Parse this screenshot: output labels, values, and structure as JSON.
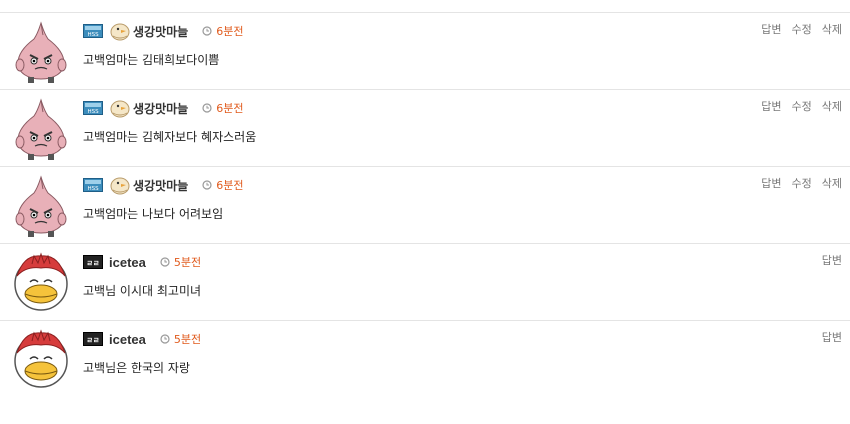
{
  "comments": [
    {
      "avatar_icon": "garlic-character-icon",
      "level_icon": "level-badge-icon",
      "nick_icon": "bird-emblem-icon",
      "nickname": "생강맛마늘",
      "time": "6분전",
      "text": "고백엄마는 김태희보다이쁨",
      "actions": {
        "reply": "답변",
        "edit": "수정",
        "delete": "삭제"
      }
    },
    {
      "avatar_icon": "garlic-character-icon",
      "level_icon": "level-badge-icon",
      "nick_icon": "bird-emblem-icon",
      "nickname": "생강맛마늘",
      "time": "6분전",
      "text": "고백엄마는 김혜자보다 혜자스러움",
      "actions": {
        "reply": "답변",
        "edit": "수정",
        "delete": "삭제"
      }
    },
    {
      "avatar_icon": "garlic-character-icon",
      "level_icon": "level-badge-icon",
      "nick_icon": "bird-emblem-icon",
      "nickname": "생강맛마늘",
      "time": "6분전",
      "text": "고백엄마는 나보다 어려보임",
      "actions": {
        "reply": "답변",
        "edit": "수정",
        "delete": "삭제"
      }
    },
    {
      "avatar_icon": "bird-mascot-icon",
      "level_icon": "level-badge-icon",
      "nickname": "icetea",
      "time": "5분전",
      "text": "고백님 이시대 최고미녀",
      "actions": {
        "reply": "답변"
      }
    },
    {
      "avatar_icon": "bird-mascot-icon",
      "level_icon": "level-badge-icon",
      "nickname": "icetea",
      "time": "5분전",
      "text": "고백님은 한국의 자랑",
      "actions": {
        "reply": "답변"
      }
    }
  ],
  "colors": {
    "time": "#e05a1c",
    "divider": "#e4e4e4",
    "action": "#777777"
  }
}
